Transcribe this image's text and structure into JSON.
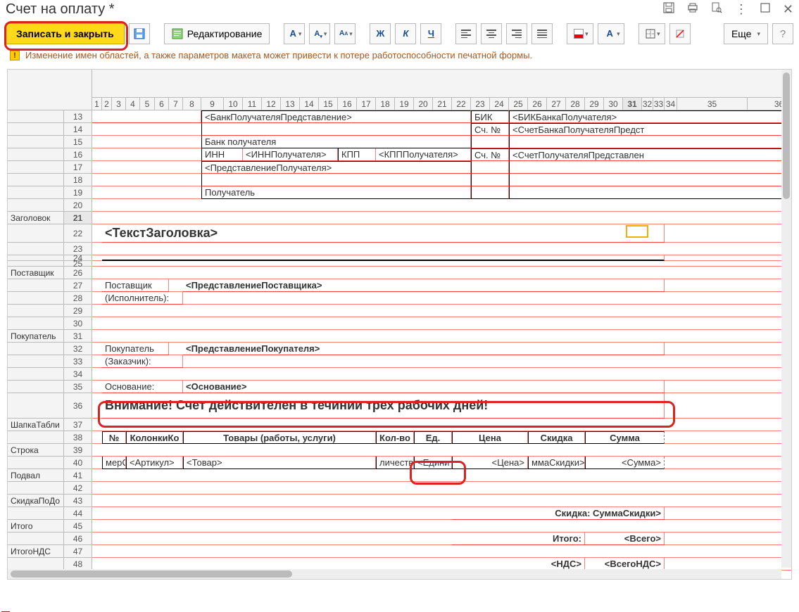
{
  "title": "Счет на оплату *",
  "toolbar": {
    "save_close": "Записать и закрыть",
    "edit": "Редактирование",
    "more": "Еще"
  },
  "warning": "Изменение имен областей, а также параметров макета может привести к потере работоспособности печатной формы.",
  "columns": [
    "1",
    "2",
    "3",
    "4",
    "5",
    "6",
    "7",
    "8",
    "9",
    "10",
    "11",
    "12",
    "13",
    "14",
    "15",
    "16",
    "17",
    "18",
    "19",
    "20",
    "21",
    "22",
    "23",
    "24",
    "25",
    "26",
    "27",
    "28",
    "29",
    "30",
    "31",
    "32",
    "33",
    "34",
    "35",
    "36"
  ],
  "row_numbers": [
    "13",
    "14",
    "15",
    "16",
    "17",
    "18",
    "19",
    "20",
    "21",
    "22",
    "23",
    "24",
    "25",
    "26",
    "27",
    "28",
    "29",
    "30",
    "31",
    "32",
    "33",
    "34",
    "35",
    "36",
    "37",
    "38",
    "39",
    "40",
    "41",
    "42",
    "43",
    "44",
    "45",
    "46",
    "47",
    "48"
  ],
  "sections": {
    "21": "Заголовок",
    "26": "Поставщик",
    "31": "Покупатель",
    "37": "ШапкаТабли",
    "39": "Строка",
    "41": "Подвал",
    "43": "СкидкаПоДо",
    "45": "Итого",
    "47": "ИтогоНДС"
  },
  "cells": {
    "bank_repr": "<БанкПолучателяПредставление>",
    "bank_label": "Банк получателя",
    "inn": "ИНН",
    "inn_val": "<ИННПолучателя>",
    "kpp": "КПП",
    "kpp_val": "<КПППолучателя>",
    "recipient_repr": "<ПредставлениеПолучателя>",
    "recipient_label": "Получатель",
    "bik": "БИК",
    "bik_val": "<БИКБанкаПолучателя>",
    "acct": "Сч. №",
    "bank_acct": "<СчетБанкаПолучателяПредст",
    "recipient_acct": "<СчетПолучателяПредставлен",
    "heading": "<ТекстЗаголовка>",
    "supplier_label": "Поставщик",
    "executor": "(Исполнитель):",
    "supplier_repr": "<ПредставлениеПоставщика>",
    "buyer_label": "Покупатель",
    "customer": "(Заказчик):",
    "buyer_repr": "<ПредставлениеПокупателя>",
    "basis_label": "Основание:",
    "basis_val": "<Основание>",
    "attention": "Внимание! Счет действителен в течинии трех рабочих дней!",
    "th_no": "№",
    "th_art": "КолонкиКо",
    "th_goods": "Товары (работы, услуги)",
    "th_qty": "Кол-во",
    "th_unit": "Ед.",
    "th_price": "Цена",
    "th_discount": "Скидка",
    "th_sum": "Сумма",
    "td_rownum": "мерСтр",
    "td_art": "<Артикул>",
    "td_goods": "<Товар>",
    "td_qty": "личество>",
    "td_unit": "<Едини",
    "td_price": "<Цена>",
    "td_discount": "ммаСкидки>",
    "td_sum": "<Сумма>",
    "discount_total": "Скидка: СуммаСкидки>",
    "total_label": "Итого:",
    "total_val": "<Всего>",
    "vat_label": "<НДС>",
    "vat_val": "<ВсегоНДС>"
  }
}
